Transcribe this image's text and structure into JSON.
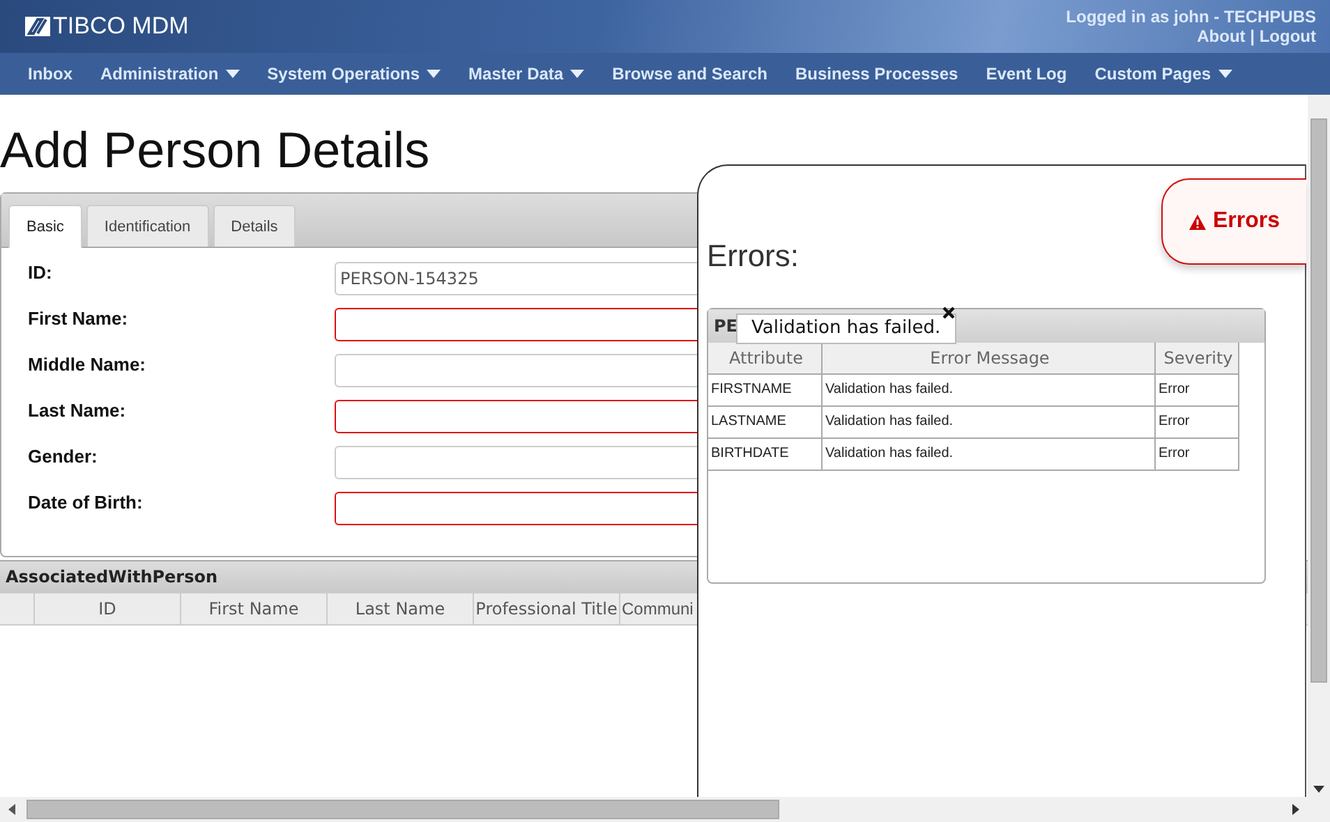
{
  "header": {
    "logo": "TIBCO MDM",
    "user": "Logged in as  john - TECHPUBS",
    "links": [
      "About",
      "Logout"
    ],
    "separator": "|"
  },
  "nav": [
    {
      "label": "Inbox",
      "dropdown": false
    },
    {
      "label": "Administration",
      "dropdown": true
    },
    {
      "label": "System Operations",
      "dropdown": true
    },
    {
      "label": "Master Data",
      "dropdown": true
    },
    {
      "label": "Browse and Search",
      "dropdown": false
    },
    {
      "label": "Business Processes",
      "dropdown": false
    },
    {
      "label": "Event Log",
      "dropdown": false
    },
    {
      "label": "Custom Pages",
      "dropdown": true
    }
  ],
  "page_title": "Add Person Details",
  "tabs": [
    {
      "label": "Basic",
      "selected": true
    },
    {
      "label": "Identification",
      "selected": false
    },
    {
      "label": "Details",
      "selected": false
    }
  ],
  "fields": [
    {
      "label": "ID:",
      "value": "PERSON-154325",
      "error": false
    },
    {
      "label": "First Name:",
      "error": true
    },
    {
      "label": "Middle Name:",
      "error": false
    },
    {
      "label": "Last Name:",
      "error": true
    },
    {
      "label": "Gender:",
      "error": false
    },
    {
      "label": "Date of Birth:",
      "error": true
    }
  ],
  "associated": {
    "title": "AssociatedWithPerson",
    "columns": [
      "ID",
      "First Name",
      "Last Name",
      "Professional Title",
      "Communi"
    ]
  },
  "errors_panel": {
    "title": "Errors:",
    "badge": "Errors",
    "grid_title": "PE",
    "tooltip": "Validation has failed.",
    "columns": [
      "Attribute",
      "Error Message",
      "Severity"
    ],
    "rows": [
      [
        "FIRSTNAME",
        "Validation has failed.",
        "Error"
      ],
      [
        "LASTNAME",
        "Validation has failed.",
        "Error"
      ],
      [
        "BIRTHDATE",
        "Validation has failed.",
        "Error"
      ]
    ]
  }
}
